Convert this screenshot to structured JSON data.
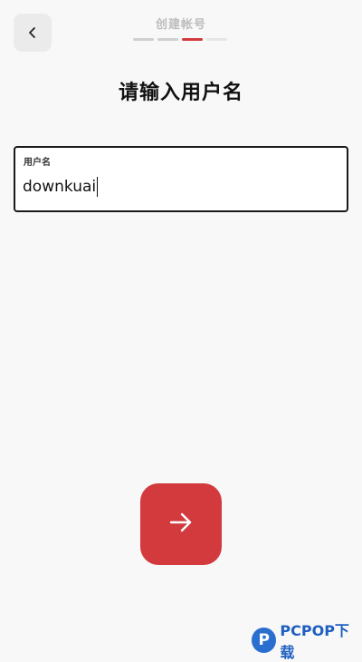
{
  "header": {
    "step_title": "创建帐号",
    "progress": {
      "total_steps": 4,
      "current_step": 3
    }
  },
  "page": {
    "title": "请输入用户名"
  },
  "username_field": {
    "label": "用户名",
    "value": "downkuai"
  },
  "icons": {
    "back": "chevron-left-icon",
    "next": "arrow-right-icon"
  },
  "colors": {
    "accent": "#d33a3d",
    "background": "#f8f8f8"
  },
  "watermark": {
    "logo": "P",
    "text": "PCPOP下载"
  }
}
